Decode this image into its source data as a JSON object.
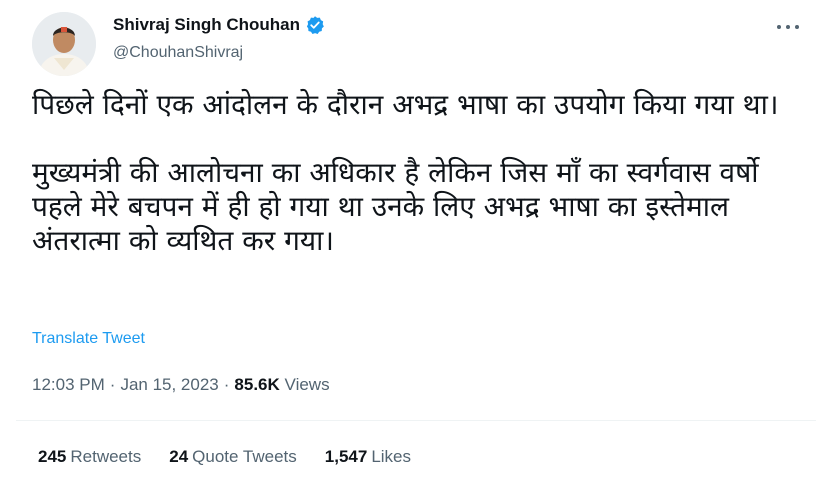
{
  "author": {
    "display_name": "Shivraj Singh Chouhan",
    "handle": "@ChouhanShivraj",
    "verified_icon": "verified-badge-icon",
    "verified_color": "#1d9bf0"
  },
  "tweet": {
    "text": "पिछले दिनों एक आंदोलन के दौरान अभद्र भाषा का उपयोग किया गया था।\n\nमुख्यमंत्री की आलोचना का अधिकार है लेकिन जिस माँ का स्वर्गवास वर्षो पहले मेरे बचपन में ही हो गया था उनके लिए अभद्र भाषा का इस्तेमाल अंतरात्मा को व्यथित कर गया।",
    "translate_label": "Translate Tweet"
  },
  "meta": {
    "time": "12:03 PM",
    "separator": "·",
    "date": "Jan 15, 2023",
    "views_count": "85.6K",
    "views_label": "Views"
  },
  "stats": {
    "retweets_count": "245",
    "retweets_label": "Retweets",
    "quotes_count": "24",
    "quotes_label": "Quote Tweets",
    "likes_count": "1,547",
    "likes_label": "Likes"
  },
  "colors": {
    "link": "#1d9bf0",
    "secondary_text": "#536471",
    "primary_text": "#0f1419",
    "divider": "#eff3f4"
  }
}
